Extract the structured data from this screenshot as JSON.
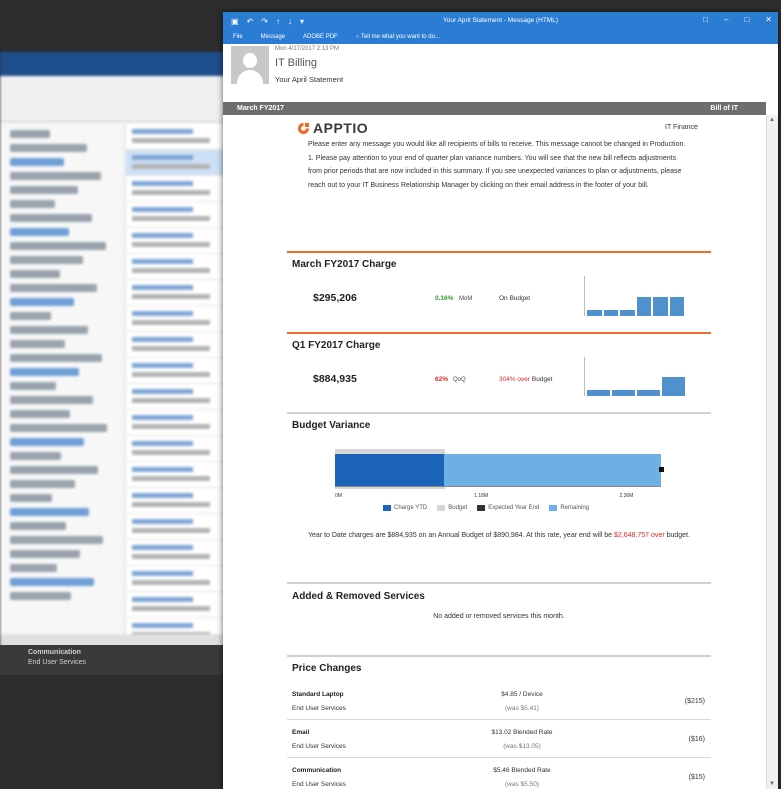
{
  "window": {
    "title": "Your April Statement - Message (HTML)",
    "menu": [
      "File",
      "Message",
      "ADOBE PDF"
    ],
    "tell_me": "Tell me what you want to do..."
  },
  "message": {
    "date": "Mon 4/17/2017 2:13 PM",
    "sender": "IT Billing",
    "subject": "Your April Statement"
  },
  "band": {
    "left": "March FY2017",
    "right": "Bill of IT"
  },
  "brand": {
    "name": "APPTIO",
    "org": "IT Finance",
    "accent": "#ee6b2b"
  },
  "intro": {
    "p1": "Please enter any message you would like all recipients of bills to receive. This message cannot be changed in Production.",
    "p2": "1. Please pay attention to your end of quarter plan variance numbers. You will see that the new bill reflects adjustments from prior periods that are now included in this summary. If you see unexpected variances to plan or adjustments, please reach out to your IT Business Relationship Manager by clicking on their email address in the footer of your bill."
  },
  "monthly": {
    "title": "March FY2017 Charge",
    "amount": "$295,206",
    "pct": "0.16%",
    "pct_label": "MoM",
    "status": "On Budget"
  },
  "quarterly": {
    "title": "Q1 FY2017 Charge",
    "amount": "$884,935",
    "pct": "62%",
    "pct_label": "QoQ",
    "status_red": "304% over",
    "status_rest": "Budget"
  },
  "budget_variance": {
    "title": "Budget Variance",
    "text_1": "Year to Date charges are $884,935 on an Annual Budget of $890,984. At this rate, year end will be",
    "text_red_1": "$2,648,757",
    "text_red_2": "over",
    "text_2": "budget.",
    "legend": [
      "Charge YTD",
      "Budget",
      "Expected Year End",
      "Remaining"
    ],
    "ticks": [
      "0M",
      "1.18M",
      "2.36M"
    ]
  },
  "added_removed": {
    "title": "Added & Removed Services",
    "empty": "No added or removed services this month."
  },
  "price_changes": {
    "title": "Price Changes",
    "rows": [
      {
        "name": "Standard Laptop",
        "category": "End User Services",
        "rate": "$4.85 / Device",
        "was": "(was $5.41)",
        "delta": "($215)"
      },
      {
        "name": "Email",
        "category": "End User Services",
        "rate": "$13.02 Blended Rate",
        "was": "(was $13.05)",
        "delta": "($16)"
      },
      {
        "name": "Communication",
        "category": "End User Services",
        "rate": "$5.46 Blended Rate",
        "was": "(was $5.50)",
        "delta": "($15)"
      }
    ]
  },
  "background": {
    "under_title": "Communication",
    "under_sub": "End User Services"
  },
  "chart_data": [
    {
      "type": "bar",
      "values": [
        1,
        1,
        1,
        3,
        3,
        3
      ]
    },
    {
      "type": "bar",
      "values": [
        1,
        1,
        1,
        3
      ]
    },
    {
      "type": "bar",
      "orientation": "horizontal",
      "series": [
        {
          "name": "Charge YTD",
          "value": 884935
        },
        {
          "name": "Budget",
          "value": 890984
        },
        {
          "name": "Expected Year End",
          "value": 2648757
        },
        {
          "name": "Remaining",
          "value": 2648757
        }
      ],
      "xlim": [
        0,
        2648757
      ],
      "x_ticks": [
        "0M",
        "1.18M",
        "2.36M"
      ],
      "colors": {
        "ytd": "#1c64ba",
        "budget": "#d6d6d6",
        "year_end": "#111111",
        "remaining": "#6db0e6"
      }
    }
  ]
}
